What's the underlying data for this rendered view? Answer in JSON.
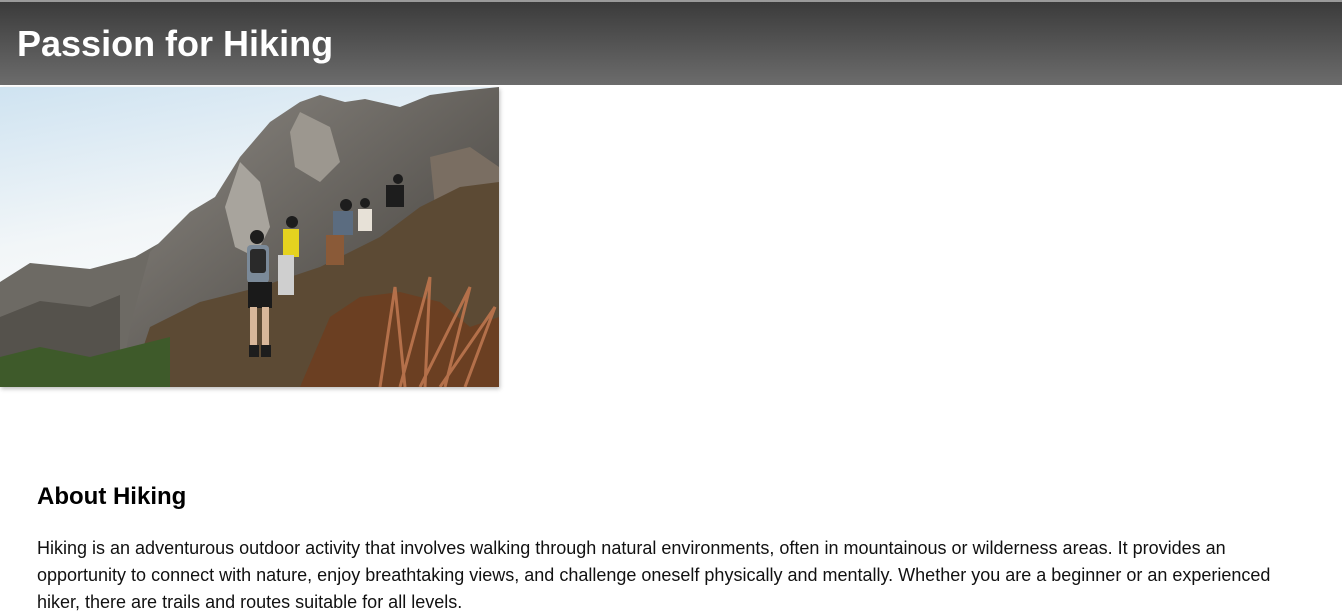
{
  "header": {
    "title": "Passion for Hiking"
  },
  "hero": {
    "image_alt": "hikers-on-rocky-mountain-trail"
  },
  "about": {
    "heading": "About Hiking",
    "paragraph": "Hiking is an adventurous outdoor activity that involves walking through natural environments, often in mountainous or wilderness areas. It provides an opportunity to connect with nature, enjoy breathtaking views, and challenge oneself physically and mentally. Whether you are a beginner or an experienced hiker, there are trails and routes suitable for all levels."
  }
}
